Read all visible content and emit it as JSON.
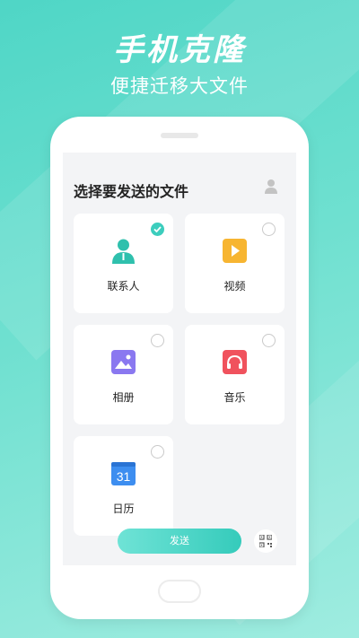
{
  "header": {
    "title": "手机克隆",
    "subtitle": "便捷迁移大文件"
  },
  "screen": {
    "title": "选择要发送的文件",
    "categories": [
      {
        "label": "联系人",
        "icon": "contacts-icon",
        "selected": true
      },
      {
        "label": "视频",
        "icon": "video-icon",
        "selected": false
      },
      {
        "label": "相册",
        "icon": "album-icon",
        "selected": false
      },
      {
        "label": "音乐",
        "icon": "music-icon",
        "selected": false
      },
      {
        "label": "日历",
        "icon": "calendar-icon",
        "selected": false,
        "icon_text": "31"
      }
    ],
    "send_label": "发送"
  },
  "colors": {
    "accent": "#3ccdbd",
    "video": "#f7b531",
    "album": "#8a78f0",
    "music": "#f0525d",
    "calendar": "#3d8ef0"
  }
}
